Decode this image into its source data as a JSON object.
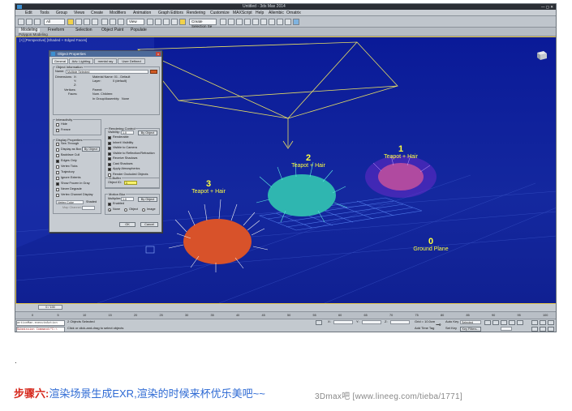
{
  "window": {
    "title": "Untitled - 3ds Max 2014",
    "menus": [
      "Edit",
      "Tools",
      "Group",
      "Views",
      "Create",
      "Modifiers",
      "Animation",
      "Graph Editors",
      "Rendering",
      "Customize",
      "MAXScript",
      "Help",
      "Allembic",
      "Ornatrix"
    ],
    "workspace": "Workspace: Default",
    "view_dropdown": "View",
    "selection_set": "Create Selection Se",
    "ribbon_tabs": [
      "Modeling",
      "Freeform",
      "Selection",
      "Object Paint",
      "Populate"
    ],
    "ribbon_sub": "Polygon Modeling"
  },
  "viewport": {
    "label": "[+] [Perspective] [Shaded + Edged Faces]",
    "objects": [
      {
        "number": "3",
        "name": "Teapot + Hair"
      },
      {
        "number": "2",
        "name": "Teapot + Hair"
      },
      {
        "number": "1",
        "name": "Teapot + Hair"
      },
      {
        "number": "0",
        "name": "Ground Plane"
      }
    ]
  },
  "dialog": {
    "title": "Object Properties",
    "close": "x",
    "tabs": [
      "General",
      "Adv. Lighting",
      "mental ray",
      "User Defined"
    ],
    "object_information": "Object Information",
    "name_label": "Name:",
    "name_value": "Multiple Selected",
    "dimensions_label": "Dimensions:",
    "dim_x": "X:",
    "dim_y": "Y:",
    "dim_z": "Z:",
    "material_name": "Material Name: 01 - Default",
    "layer": "Layer:",
    "layer_value": "0 (default)",
    "vertices": "Vertices:",
    "faces": "Faces:",
    "parent": "Parent:",
    "num_children": "Num. Children:",
    "in_group": "In Group/Assembly:",
    "in_group_value": "None",
    "interactivity": "Interactivity",
    "hide": "Hide",
    "freeze": "Freeze",
    "display_properties": "Display Properties",
    "display_items": [
      "See-Through",
      "Display as Box",
      "Backface Cull",
      "Edges Only",
      "Vertex Ticks",
      "Trajectory",
      "Ignore Extents",
      "Show Frozen in Gray",
      "Never Degrade",
      "Vertex Channel Display"
    ],
    "display_checked": [
      false,
      false,
      false,
      true,
      false,
      false,
      false,
      true,
      false,
      false
    ],
    "by_object": "By Object",
    "vertex_color": "Vertex Color",
    "shaded": "Shaded",
    "map_channel": "Map Channel:",
    "rendering_control": "Rendering Control",
    "visibility": "Visibility:",
    "visibility_value": "1.0",
    "render_items": [
      "Renderable",
      "Inherit Visibility",
      "Visible to Camera",
      "Visible to Reflection/Refraction",
      "Receive Shadows",
      "Cast Shadows",
      "Apply Atmospherics",
      "Render Occluded Objects"
    ],
    "render_checked": [
      true,
      true,
      true,
      true,
      true,
      true,
      true,
      false
    ],
    "gbuffer": "G-Buffer",
    "object_id": "Object ID:",
    "object_id_value": "1",
    "motion_blur": "Motion Blur",
    "multiplier": "Multiplier:",
    "multiplier_value": "1.0",
    "enabled": "Enabled",
    "blur_none": "None",
    "blur_object": "Object",
    "blur_image": "Image",
    "ok": "OK",
    "cancel": "Cancel"
  },
  "timeline": {
    "frame": "0 / 100",
    "ticks": [
      "0",
      "5",
      "10",
      "15",
      "20",
      "25",
      "30",
      "35",
      "40",
      "45",
      "50",
      "55",
      "60",
      "65",
      "70",
      "75",
      "80",
      "85",
      "90",
      "95",
      "100"
    ]
  },
  "status": {
    "maxscript_line1": "actionMan.executeAction",
    "maxscript_line2": "Submission Command=\"C:\\",
    "objects_selected": "2 Objects Selected",
    "prompt": "Click or click-and-drag to select objects",
    "x_label": "X:",
    "y_label": "Y:",
    "z_label": "Z:",
    "grid": "Grid = 10.0cm",
    "add_time_tag": "Add Time Tag",
    "auto_key": "Auto Key",
    "selected": "Selected",
    "set_key": "Set Key",
    "key_filters": "Key Filters..."
  },
  "caption": {
    "dot": ".",
    "step": "步骤六:",
    "text": "渲染场景生成EXR,渲染的时候来杯优乐美吧~~",
    "watermark": "3Dmax吧  [www.lineeg.com/tieba/1771]"
  },
  "colors": {
    "viewport_bg": "#0b1ea0",
    "label_yellow": "#ffff40",
    "step_red": "#d6281c",
    "caption_blue": "#2f6bd4"
  }
}
